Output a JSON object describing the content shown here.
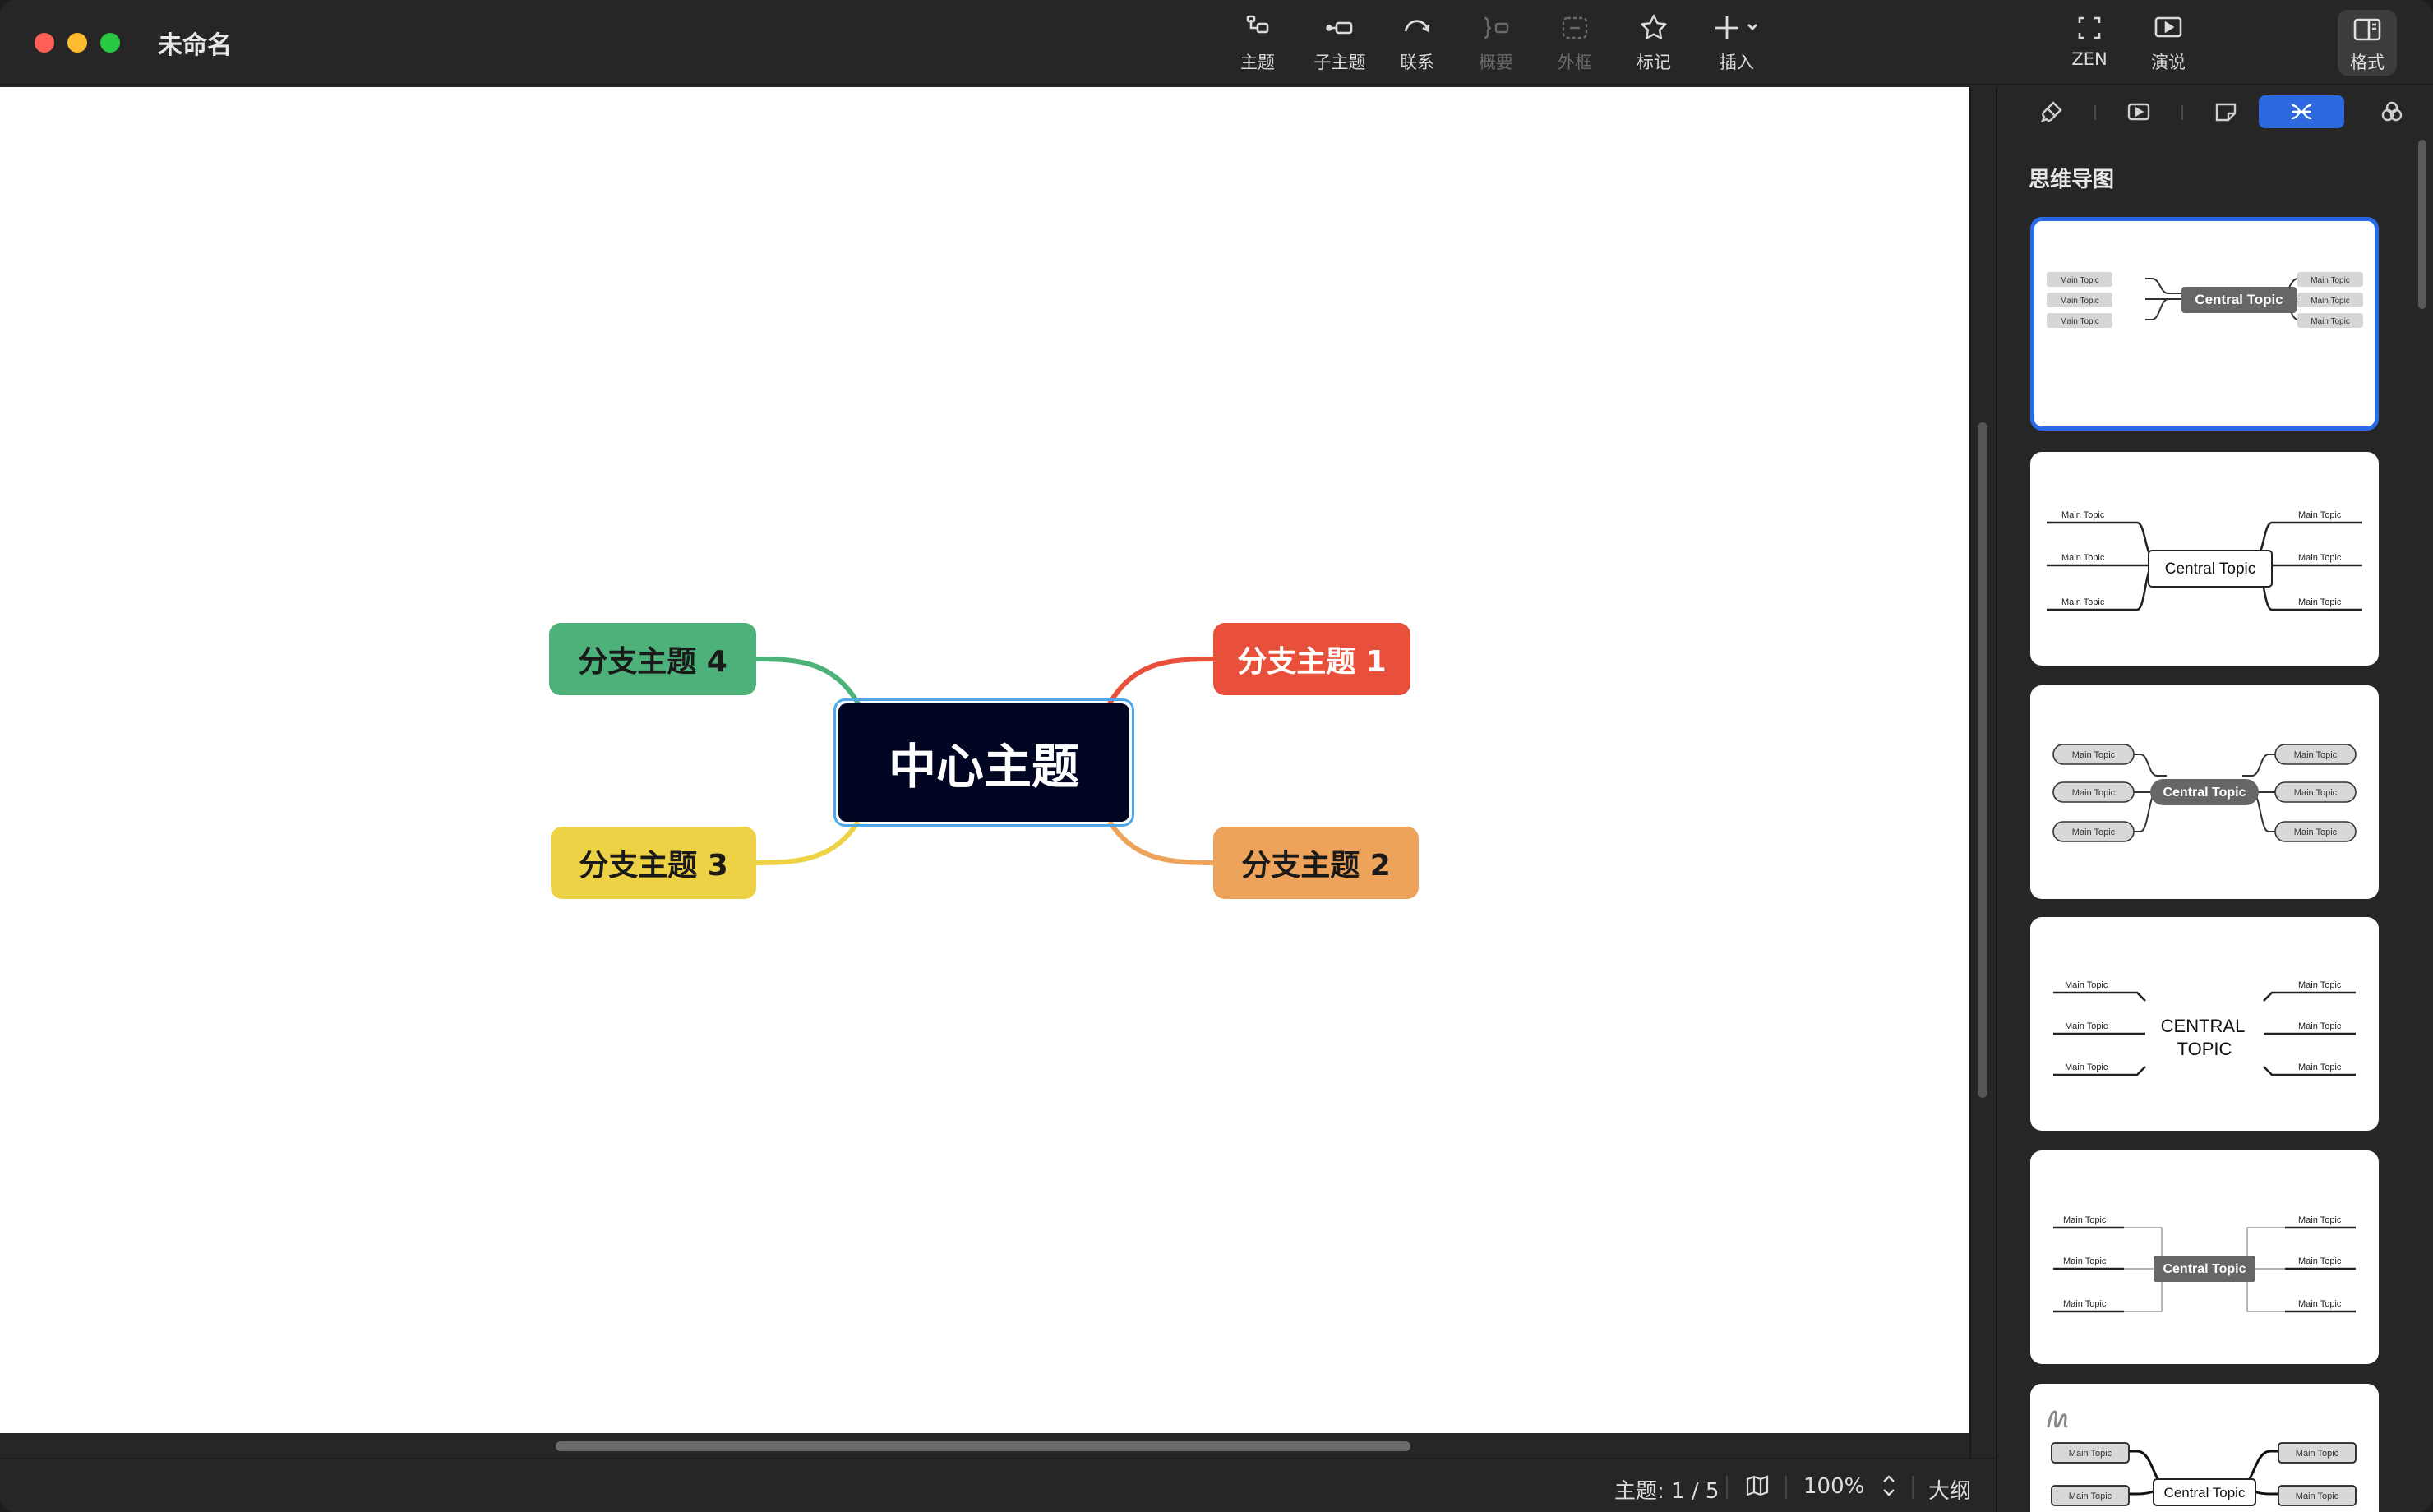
{
  "window": {
    "title": "未命名"
  },
  "toolbar": {
    "topic": "主题",
    "subtopic": "子主题",
    "relationship": "联系",
    "summary": "概要",
    "boundary": "外框",
    "marker": "标记",
    "insert": "插入",
    "zen": "ZEN",
    "present": "演说",
    "format": "格式"
  },
  "mindmap": {
    "central": "中心主题",
    "branches": [
      "分支主题 1",
      "分支主题 2",
      "分支主题 3",
      "分支主题 4"
    ],
    "colors": {
      "b1": "#e8503c",
      "b2": "#eda35a",
      "b3": "#ecd244",
      "b4": "#4cb27a",
      "central": "#000521",
      "selection": "#4da7e8"
    }
  },
  "statusbar": {
    "topic_count": "主题: 1 / 5",
    "zoom": "100%",
    "outline": "大纲"
  },
  "panel": {
    "tabs": [
      "brush-icon",
      "slideshow-icon",
      "sticky-note-icon",
      "mindmap-structure-icon",
      "theme-palette-icon"
    ],
    "active_tab": "mindmap-structure-icon",
    "section_title": "思维导图",
    "preview": {
      "central": "Central Topic",
      "central_caps": "CENTRAL TOPIC",
      "central_caps_line1": "CENTRAL",
      "central_caps_line2": "TOPIC",
      "main": "Main Topic"
    },
    "accent": "#2a6ae6"
  }
}
